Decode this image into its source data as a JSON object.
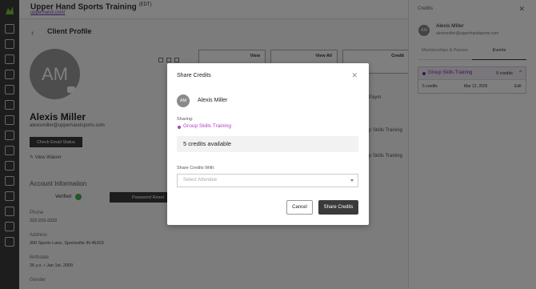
{
  "header": {
    "brand": "Upper Hand Sports Training",
    "brand_sup": "(EDT)",
    "brand_link": "upperhand.com/"
  },
  "profile": {
    "page_title": "Client Profile",
    "avatar_initials": "AM",
    "name": "Alexis Miller",
    "email": "alexismiller@upperhandsports.com",
    "check_email_label": "Check Email Status",
    "view_waiver_label": "View Waiver",
    "account_info_label": "Account Information",
    "verified_label": "Verified",
    "password_reset_label": "Password Reset",
    "phone_label": "Phone",
    "phone_value": "222-222-2222",
    "address_label": "Address",
    "address_value": "300 Sports Lane, Sportsville IN 46203",
    "birthdate_label": "Birthdate",
    "birthdate_value": "26 y.o. • Jan 1st, 2000",
    "gender_label": "Gender",
    "cards": [
      "View",
      "View All",
      "Credit"
    ],
    "payment_fragment": "Paym",
    "side_fragments": [
      "p Skills Training",
      "p Skills Training"
    ]
  },
  "drawer": {
    "title": "Credits",
    "avatar_initials": "AM",
    "name": "Alexis Miller",
    "email": "alexismiller@upperhandsports.com",
    "tabs": [
      "Memberships & Passes",
      "Events"
    ],
    "credit": {
      "event_name": "Group Skills Training",
      "count": "5 credits",
      "row_credits": "5 credits",
      "row_date": "Mar 12, 2026",
      "row_action": "Edit"
    }
  },
  "modal": {
    "title": "Share Credits",
    "avatar_initials": "AM",
    "client_name": "Alexis Miller",
    "sharing_label": "Sharing:",
    "event_name": "Group Skills Training",
    "available": "5 credits available",
    "share_with_label": "Share Credits With:",
    "select_placeholder": "Select Attendee",
    "cancel_label": "Cancel",
    "share_label": "Share Credits"
  },
  "colors": {
    "accent": "#b03fc0",
    "dark_button": "#3a3a3a",
    "verified": "#4caf50"
  }
}
